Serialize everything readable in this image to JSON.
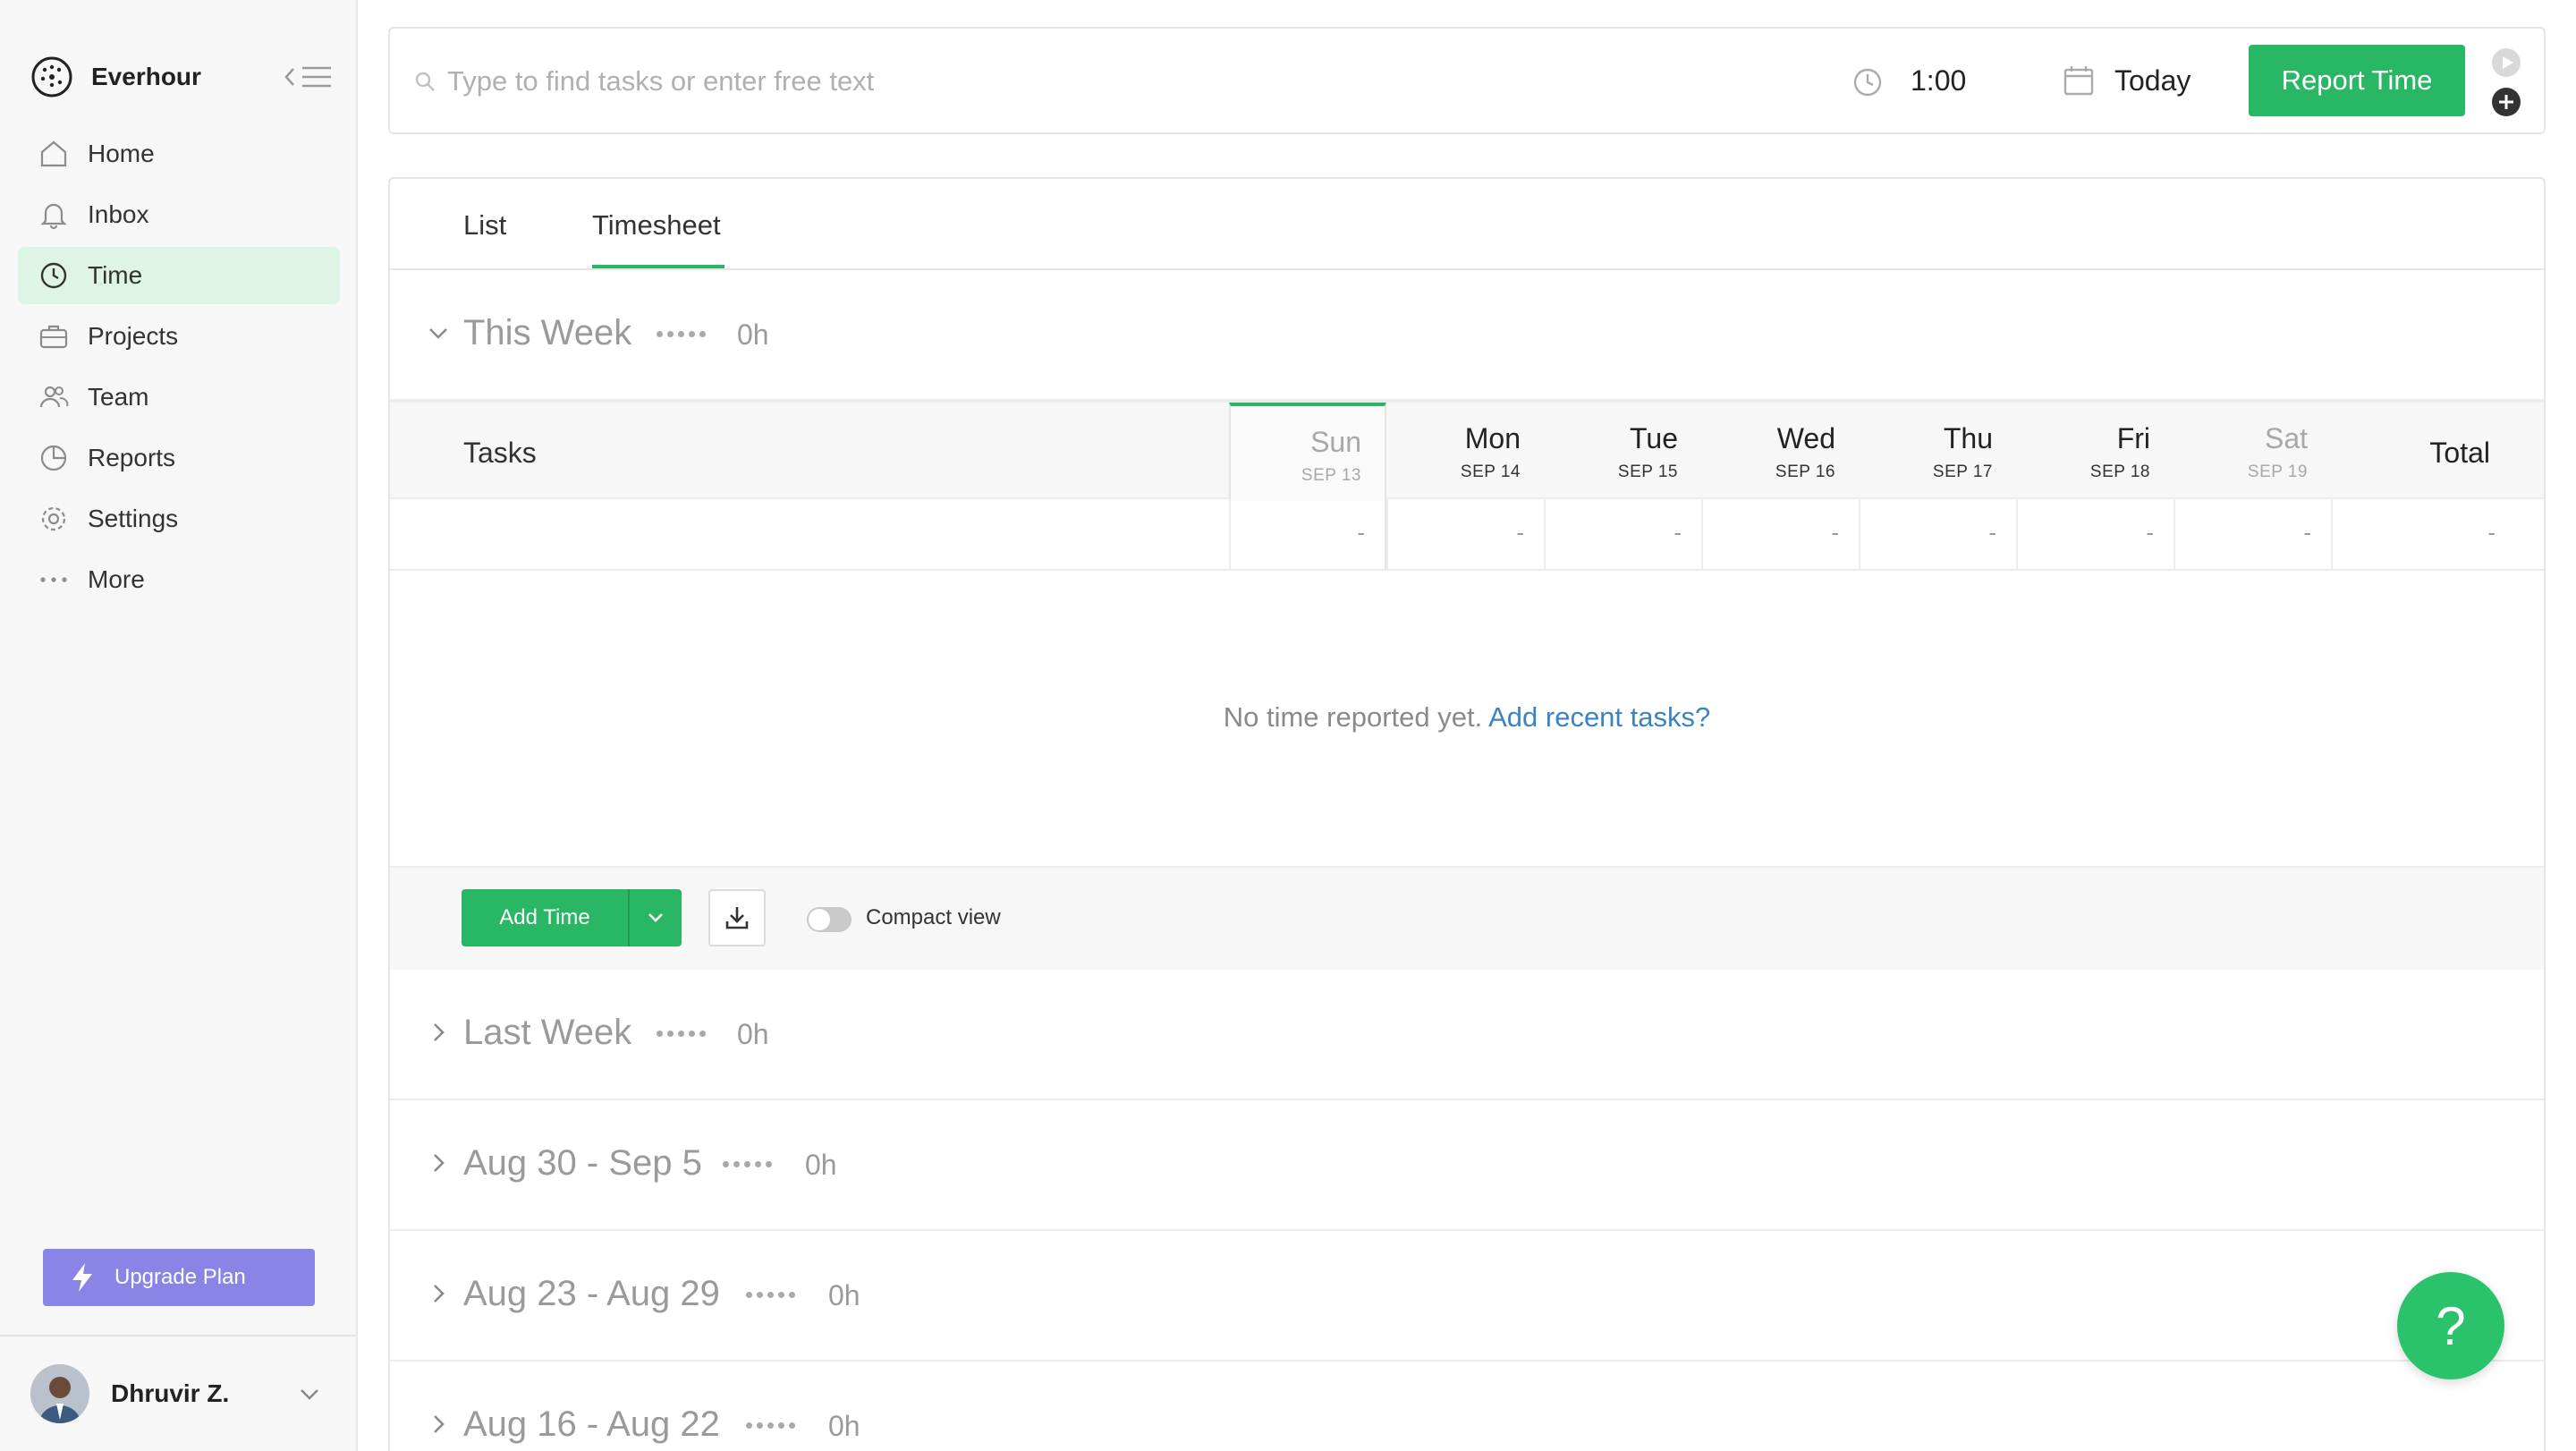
{
  "app": {
    "name": "Everhour"
  },
  "sidebar": {
    "items": [
      {
        "label": "Home",
        "icon": "home-icon"
      },
      {
        "label": "Inbox",
        "icon": "bell-icon"
      },
      {
        "label": "Time",
        "icon": "clock-icon",
        "active": true
      },
      {
        "label": "Projects",
        "icon": "briefcase-icon"
      },
      {
        "label": "Team",
        "icon": "people-icon"
      },
      {
        "label": "Reports",
        "icon": "pie-chart-icon"
      },
      {
        "label": "Settings",
        "icon": "gear-icon"
      },
      {
        "label": "More",
        "icon": "more-dots-icon"
      }
    ],
    "upgrade_label": "Upgrade Plan",
    "user_name": "Dhruvir Z."
  },
  "topbar": {
    "search_placeholder": "Type to find tasks or enter free text",
    "duration": "1:00",
    "date": "Today",
    "report_button": "Report Time"
  },
  "tabs": {
    "list": "List",
    "timesheet": "Timesheet",
    "active": "Timesheet"
  },
  "this_week": {
    "title": "This Week",
    "total": "0h",
    "tasks_label": "Tasks",
    "total_label": "Total",
    "days": [
      {
        "name": "Sun",
        "date": "SEP 13",
        "today": true,
        "muted": true
      },
      {
        "name": "Mon",
        "date": "SEP 14"
      },
      {
        "name": "Tue",
        "date": "SEP 15"
      },
      {
        "name": "Wed",
        "date": "SEP 16"
      },
      {
        "name": "Thu",
        "date": "SEP 17"
      },
      {
        "name": "Fri",
        "date": "SEP 18"
      },
      {
        "name": "Sat",
        "date": "SEP 19",
        "muted": true
      }
    ],
    "row_values": [
      "-",
      "-",
      "-",
      "-",
      "-",
      "-",
      "-",
      "-"
    ],
    "empty_text": "No time reported yet.",
    "empty_link": "Add recent tasks?"
  },
  "footer": {
    "add_time": "Add Time",
    "compact_view": "Compact view"
  },
  "weeks": [
    {
      "title": "Last Week",
      "total": "0h"
    },
    {
      "title": "Aug 30 - Sep 5",
      "total": "0h"
    },
    {
      "title": "Aug 23 - Aug 29",
      "total": "0h"
    },
    {
      "title": "Aug 16 - Aug 22",
      "total": "0h"
    }
  ],
  "help": {
    "label": "?"
  },
  "colors": {
    "accent": "#29b765",
    "upgrade": "#8a84e6",
    "link": "#3a83c4",
    "active_nav": "#def5e5"
  }
}
